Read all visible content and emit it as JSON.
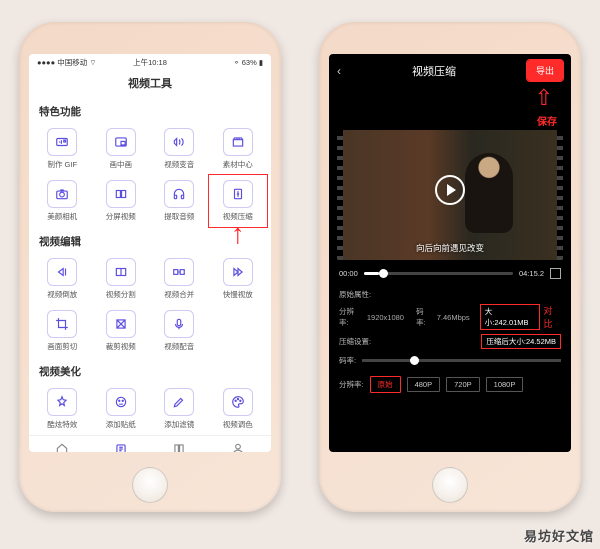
{
  "left": {
    "status": {
      "carrier": "中国移动",
      "signal": "●●●●",
      "wifi": "⌔",
      "time": "上午10:18",
      "battery": "63%"
    },
    "page_title": "视频工具",
    "sections": [
      {
        "heading": "特色功能",
        "items": [
          {
            "label": "制作 GIF",
            "icon": "gif"
          },
          {
            "label": "画中画",
            "icon": "pip"
          },
          {
            "label": "视频变音",
            "icon": "voice"
          },
          {
            "label": "素材中心",
            "icon": "assets"
          },
          {
            "label": "美颜相机",
            "icon": "camera"
          },
          {
            "label": "分屏视频",
            "icon": "split"
          },
          {
            "label": "提取音频",
            "icon": "audio"
          },
          {
            "label": "视频压缩",
            "icon": "compress",
            "highlight": true
          }
        ]
      },
      {
        "heading": "视频编辑",
        "items": [
          {
            "label": "视频倒放",
            "icon": "reverse"
          },
          {
            "label": "视频分割",
            "icon": "cut"
          },
          {
            "label": "视频合并",
            "icon": "merge"
          },
          {
            "label": "快慢视放",
            "icon": "speed"
          },
          {
            "label": "画面剪切",
            "icon": "crop"
          },
          {
            "label": "裁剪视频",
            "icon": "trim"
          },
          {
            "label": "视频配音",
            "icon": "dub"
          }
        ]
      },
      {
        "heading": "视频美化",
        "items": [
          {
            "label": "酷炫特效",
            "icon": "fx"
          },
          {
            "label": "添加贴纸",
            "icon": "sticker"
          },
          {
            "label": "添加滤镜",
            "icon": "filter"
          },
          {
            "label": "视频调色",
            "icon": "palette"
          }
        ]
      }
    ],
    "bottom": [
      {
        "label": "首页",
        "icon": "home"
      },
      {
        "label": "工具",
        "icon": "tools",
        "active": true
      },
      {
        "label": "教程",
        "icon": "book"
      },
      {
        "label": "我的",
        "icon": "user"
      }
    ]
  },
  "right": {
    "title": "视频压缩",
    "export": "导出",
    "save_label": "保存",
    "caption": "向后向前遇见改变",
    "time_start": "00:00",
    "time_end": "04:15.2",
    "orig_heading": "原始属性:",
    "orig_res_label": "分辨率:",
    "orig_res": "1920x1080",
    "orig_bitrate_label": "码率:",
    "orig_bitrate": "7.46Mbps",
    "orig_size_label": "大小:",
    "orig_size": "242.01MB",
    "compare": "对比",
    "comp_heading": "压缩设置:",
    "comp_size_label": "压缩后大小:",
    "comp_size": "24.52MB",
    "bitrate_lbl": "码率:",
    "res_lbl": "分辨率:",
    "res_opts": [
      "原始",
      "480P",
      "720P",
      "1080P"
    ]
  },
  "watermark": "易坊好文馆"
}
